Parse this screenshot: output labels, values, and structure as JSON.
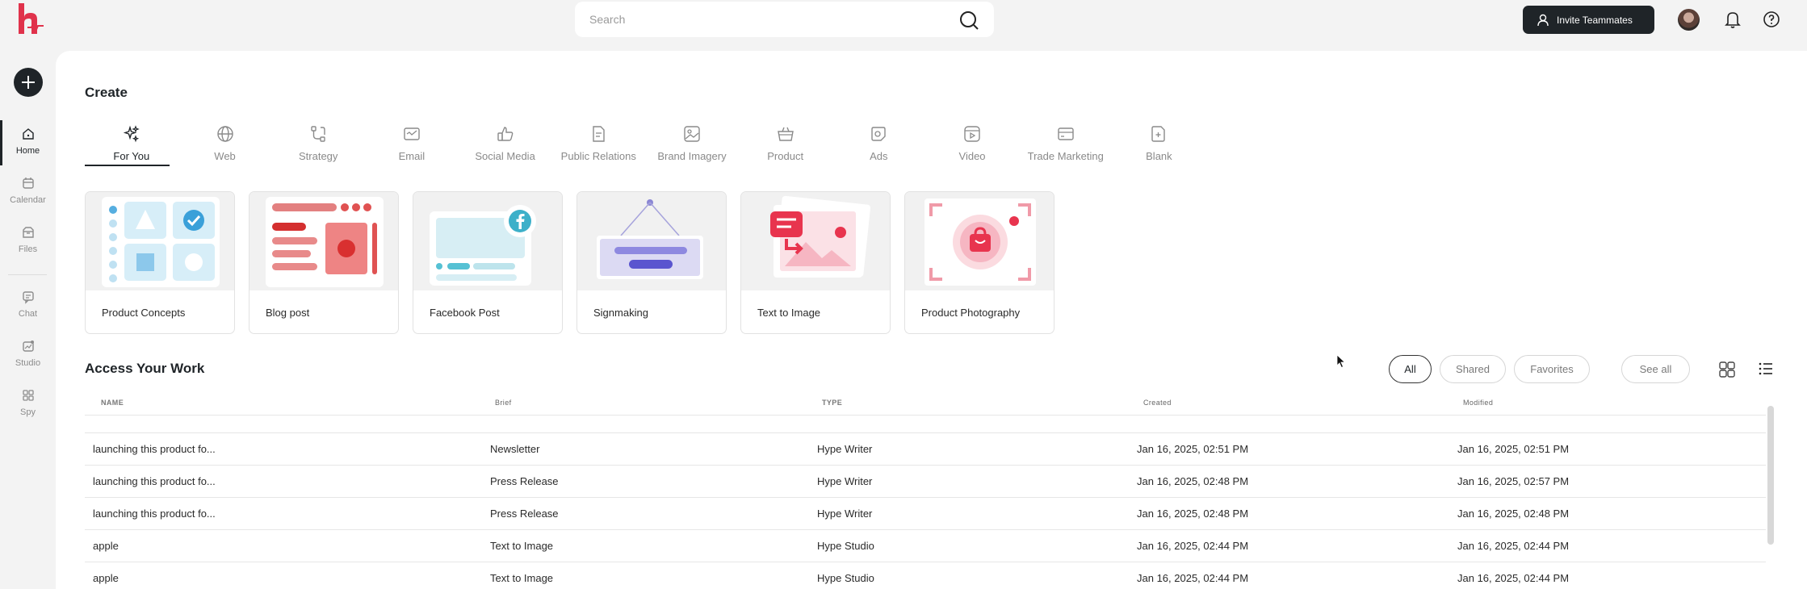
{
  "header": {
    "search_placeholder": "Search",
    "invite_label": "Invite Teammates"
  },
  "sidebar": {
    "items": [
      {
        "label": "Home",
        "icon": "home-icon",
        "active": true
      },
      {
        "label": "Calendar",
        "icon": "calendar-icon"
      },
      {
        "label": "Files",
        "icon": "files-icon"
      },
      {
        "label": "Chat",
        "icon": "chat-icon"
      },
      {
        "label": "Studio",
        "icon": "studio-icon"
      },
      {
        "label": "Spy",
        "icon": "spy-icon"
      }
    ]
  },
  "create": {
    "title": "Create",
    "tabs": [
      {
        "label": "For You",
        "icon": "sparkles-icon",
        "active": true
      },
      {
        "label": "Web",
        "icon": "globe-icon"
      },
      {
        "label": "Strategy",
        "icon": "strategy-icon"
      },
      {
        "label": "Email",
        "icon": "email-icon"
      },
      {
        "label": "Social Media",
        "icon": "thumbs-up-icon"
      },
      {
        "label": "Public Relations",
        "icon": "document-icon"
      },
      {
        "label": "Brand Imagery",
        "icon": "image-icon"
      },
      {
        "label": "Product",
        "icon": "basket-icon"
      },
      {
        "label": "Ads",
        "icon": "ads-icon"
      },
      {
        "label": "Video",
        "icon": "video-icon"
      },
      {
        "label": "Trade Marketing",
        "icon": "card-icon"
      },
      {
        "label": "Blank",
        "icon": "blank-icon"
      }
    ],
    "cards": [
      {
        "label": "Product Concepts"
      },
      {
        "label": "Blog post"
      },
      {
        "label": "Facebook Post"
      },
      {
        "label": "Signmaking"
      },
      {
        "label": "Text to Image"
      },
      {
        "label": "Product Photography"
      }
    ]
  },
  "access": {
    "title": "Access Your Work",
    "filters": [
      "All",
      "Shared",
      "Favorites"
    ],
    "active_filter": "All",
    "see_all": "See all",
    "columns": [
      "NAME",
      "Brief",
      "TYPE",
      "Created",
      "Modified"
    ],
    "rows": [
      [
        "launching this product fo...",
        "Newsletter",
        "Hype Writer",
        "Jan 16, 2025, 02:51 PM",
        "Jan 16, 2025, 02:51 PM"
      ],
      [
        "launching this product fo...",
        "Press Release",
        "Hype Writer",
        "Jan 16, 2025, 02:48 PM",
        "Jan 16, 2025, 02:57 PM"
      ],
      [
        "launching this product fo...",
        "Press Release",
        "Hype Writer",
        "Jan 16, 2025, 02:48 PM",
        "Jan 16, 2025, 02:48 PM"
      ],
      [
        "apple",
        "Text to Image",
        "Hype Studio",
        "Jan 16, 2025, 02:44 PM",
        "Jan 16, 2025, 02:44 PM"
      ],
      [
        "apple",
        "Text to Image",
        "Hype Studio",
        "Jan 16, 2025, 02:44 PM",
        "Jan 16, 2025, 02:44 PM"
      ]
    ]
  },
  "colors": {
    "brand": "#e0324b",
    "dark": "#1f2428"
  }
}
